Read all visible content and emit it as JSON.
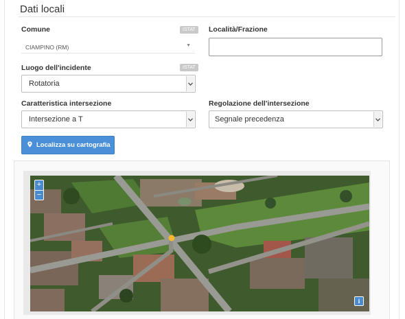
{
  "section": {
    "title": "Dati locali"
  },
  "comune": {
    "label": "Comune",
    "badge": "ISTAT",
    "value": "CIAMPINO (RM)",
    "caret": "▼"
  },
  "localita": {
    "label": "Località/Frazione",
    "value": ""
  },
  "luogo": {
    "label": "Luogo dell'incidente",
    "badge": "ISTAT",
    "value": "Rotatoria"
  },
  "caratteristica": {
    "label": "Caratteristica intersezione",
    "value": "Intersezione a T"
  },
  "regolazione": {
    "label": "Regolazione dell'intersezione",
    "value": "Segnale precedenza"
  },
  "locate_button": {
    "label": "Localizza su cartografia",
    "icon": "map-marker-icon"
  },
  "map": {
    "zoom_in": "+",
    "zoom_out": "−",
    "info": "i",
    "colors": {
      "accent": "#4a90d9",
      "marker": "#f5b82e"
    }
  }
}
